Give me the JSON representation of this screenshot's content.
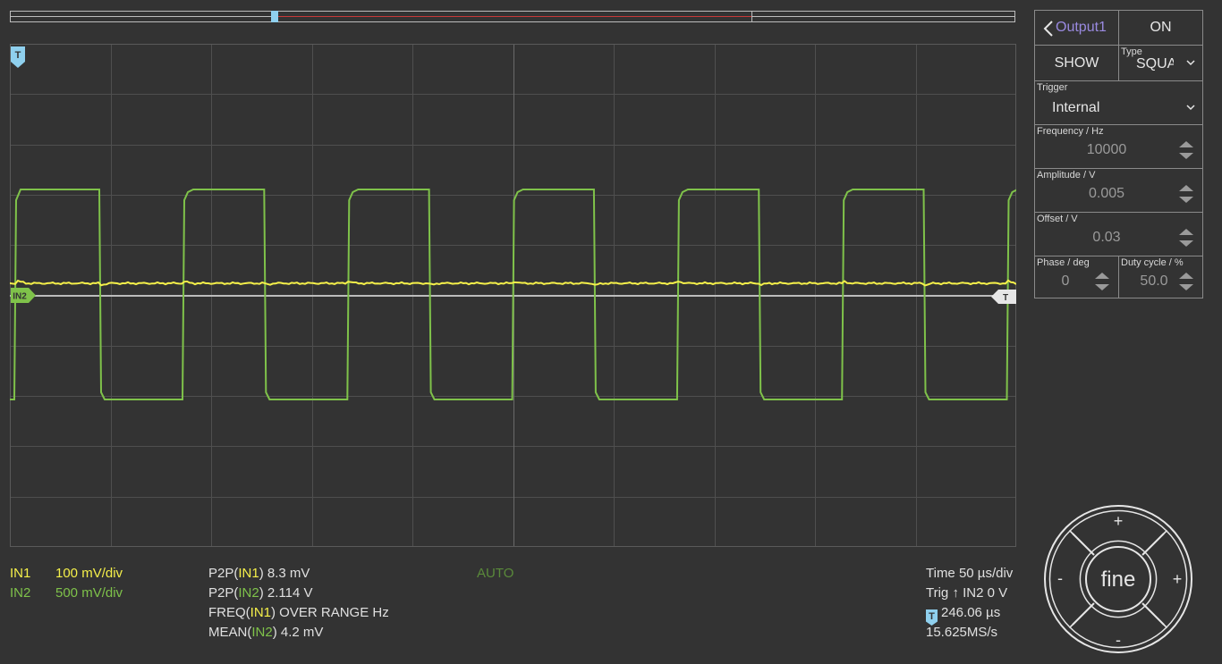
{
  "channels": {
    "in1": {
      "label": "IN1",
      "scale": "100 mV/div",
      "color": "#f5f04a"
    },
    "in2": {
      "label": "IN2",
      "scale": "500 mV/div",
      "color": "#7fc24a"
    }
  },
  "markers": {
    "trigger_time": "T",
    "in2_offset": "IN2",
    "trigger_level": "T"
  },
  "measurements": {
    "m1": {
      "prefix": "P2P(",
      "channel": "IN1",
      "suffix": ") 8.3 mV"
    },
    "m2": {
      "prefix": "P2P(",
      "channel": "IN2",
      "suffix": ") 2.114 V"
    },
    "m3": {
      "prefix": "FREQ(",
      "channel": "IN1",
      "suffix": ") OVER RANGE Hz"
    },
    "m4": {
      "prefix": "MEAN(",
      "channel": "IN2",
      "suffix": ") 4.2 mV"
    }
  },
  "mode": "AUTO",
  "timebase": {
    "time": "Time 50 µs/div",
    "trig_prefix": "Trig",
    "trig_arrow": "↑",
    "trig_suffix": "IN2 0 V",
    "trig_icon": "T",
    "trig_delay": "246.06 µs",
    "sample_rate": "15.625MS/s"
  },
  "panel": {
    "output_label": "Output1",
    "output_state": "ON",
    "show_label": "SHOW",
    "type_label": "Type",
    "type_value": "SQUA",
    "trigger_label": "Trigger",
    "trigger_value": "Internal",
    "frequency_label": "Frequency / Hz",
    "frequency_value": "10000",
    "amplitude_label": "Amplitude / V",
    "amplitude_value": "0.005",
    "offset_label": "Offset / V",
    "offset_value": "0.03",
    "phase_label": "Phase / deg",
    "phase_value": "0",
    "duty_label": "Duty cycle / %",
    "duty_value": "50.0",
    "accent_color": "#9a8ae0"
  },
  "knob": {
    "center_label": "fine",
    "plus_label": "+",
    "minus_label": "-"
  }
}
